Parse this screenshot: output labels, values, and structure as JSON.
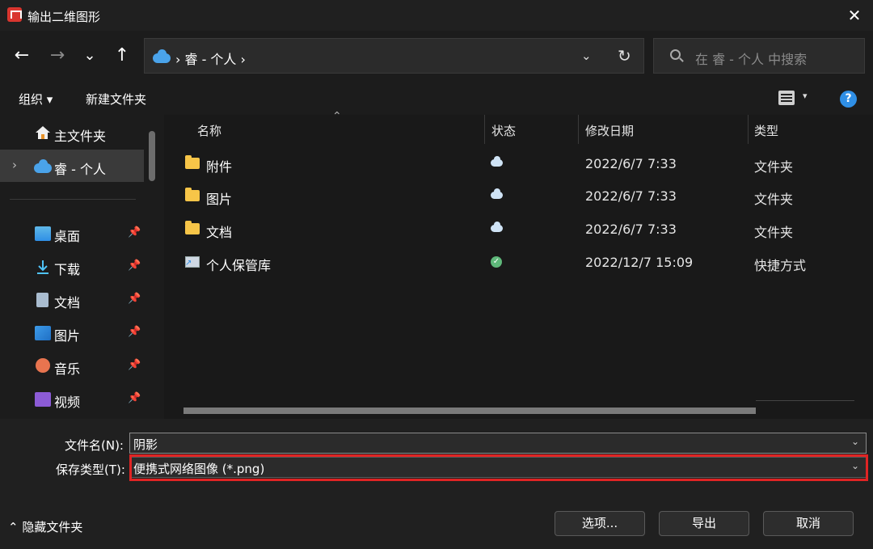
{
  "window": {
    "title": "输出二维图形",
    "close_label": "✕"
  },
  "nav": {
    "back_icon": "←",
    "forward_icon": "→",
    "recent_icon": "⌄",
    "up_icon": "↑",
    "address": {
      "crumbs": "›  睿 - 个人  ›",
      "dropdown_icon": "⌄",
      "refresh_icon": "↻"
    },
    "search_placeholder": "在 睿 - 个人 中搜索"
  },
  "toolbar": {
    "organize_label": "组织 ▾",
    "new_folder_label": "新建文件夹",
    "view_dd": "▾",
    "help_label": "?"
  },
  "sidebar": {
    "home": "主文件夹",
    "onedrive": "睿 - 个人",
    "expand": "›",
    "items": [
      {
        "label": "桌面",
        "pin": "📌"
      },
      {
        "label": "下载",
        "pin": "📌"
      },
      {
        "label": "文档",
        "pin": "📌"
      },
      {
        "label": "图片",
        "pin": "📌"
      },
      {
        "label": "音乐",
        "pin": "📌"
      },
      {
        "label": "视频",
        "pin": "📌"
      }
    ]
  },
  "columns": {
    "name": "名称",
    "status": "状态",
    "date": "修改日期",
    "type": "类型"
  },
  "files": [
    {
      "name": "附件",
      "status": "cloud",
      "date": "2022/6/7 7:33",
      "type": "文件夹"
    },
    {
      "name": "图片",
      "status": "cloud",
      "date": "2022/6/7 7:33",
      "type": "文件夹"
    },
    {
      "name": "文档",
      "status": "cloud",
      "date": "2022/6/7 7:33",
      "type": "文件夹"
    },
    {
      "name": "个人保管库",
      "status": "check",
      "date": "2022/12/7 15:09",
      "type": "快捷方式"
    }
  ],
  "form": {
    "filename_label": "文件名(N):",
    "filename_value": "阴影",
    "filetype_label": "保存类型(T):",
    "filetype_value": "便携式网络图像 (*.png)",
    "dd_icon": "⌄"
  },
  "footer": {
    "hide_folders": "⌃ 隐藏文件夹",
    "options": "选项...",
    "export": "导出",
    "cancel": "取消"
  }
}
